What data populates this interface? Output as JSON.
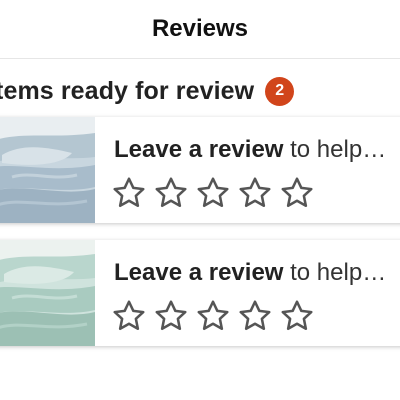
{
  "header": {
    "title": "Reviews"
  },
  "section": {
    "title": "Items ready for review",
    "badge_count": "2"
  },
  "items": [
    {
      "prompt_strong": "Leave a review",
      "prompt_rest": " to help others",
      "image": "light-blue-bedding-photo",
      "rating": 0,
      "max_rating": 5
    },
    {
      "prompt_strong": "Leave a review",
      "prompt_rest": " to help others",
      "image": "mint-green-bedding-photo",
      "rating": 0,
      "max_rating": 5
    }
  ],
  "colors": {
    "badge": "#d1451b",
    "star_outline": "#555555",
    "text": "#222222"
  },
  "icons": {
    "back": "chevron-left-icon",
    "star": "star-outline-icon"
  }
}
